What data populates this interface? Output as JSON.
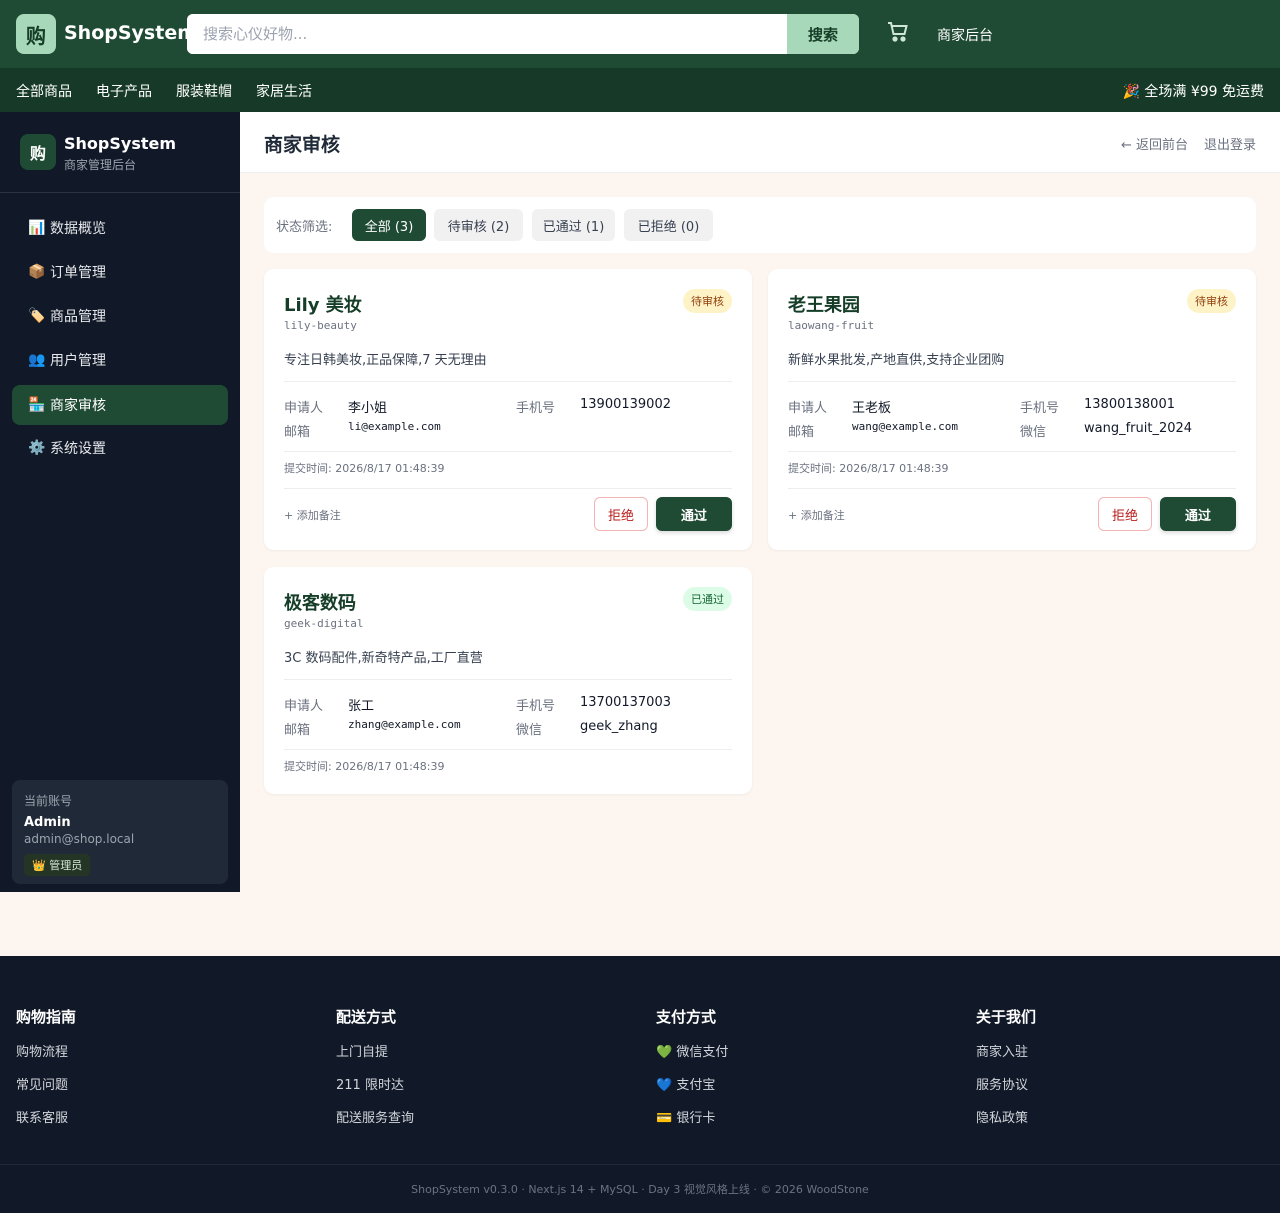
{
  "header": {
    "logo_char": "购",
    "brand": "ShopSystem",
    "search_placeholder": "搜索心仪好物...",
    "search_button": "搜索",
    "merchant_link": "商家后台"
  },
  "nav": {
    "items": [
      "全部商品",
      "电子产品",
      "服装鞋帽",
      "家居生活"
    ],
    "promo": "🎉 全场满 ¥99 免运费"
  },
  "sidebar": {
    "logo_char": "购",
    "title": "ShopSystem",
    "subtitle": "商家管理后台",
    "items": [
      {
        "icon": "📊",
        "label": "数据概览"
      },
      {
        "icon": "📦",
        "label": "订单管理"
      },
      {
        "icon": "🏷️",
        "label": "商品管理"
      },
      {
        "icon": "👥",
        "label": "用户管理"
      },
      {
        "icon": "🏪",
        "label": "商家审核"
      },
      {
        "icon": "⚙️",
        "label": "系统设置"
      }
    ],
    "active_index": 4,
    "account": {
      "label": "当前账号",
      "name": "Admin",
      "email": "admin@shop.local",
      "role": "👑 管理员"
    }
  },
  "main": {
    "title": "商家审核",
    "back_link": "← 返回前台",
    "logout": "退出登录",
    "filter": {
      "label": "状态筛选:",
      "chips": [
        "全部 (3)",
        "待审核 (2)",
        "已通过 (1)",
        "已拒绝 (0)"
      ],
      "active_index": 0
    }
  },
  "cards": [
    {
      "name": "Lily 美妆",
      "slug": "lily-beauty",
      "status": "待审核",
      "status_type": "pending",
      "desc": "专注日韩美妆,正品保障,7 天无理由",
      "applicant_label": "申请人",
      "applicant": "李小姐",
      "phone_label": "手机号",
      "phone": "13900139002",
      "email_label": "邮箱",
      "email": "li@example.com",
      "wechat_label": "",
      "wechat": "",
      "submitted": "提交时间: 2026/8/17 01:48:39",
      "add_note": "+ 添加备注",
      "reject": "拒绝",
      "approve": "通过"
    },
    {
      "name": "老王果园",
      "slug": "laowang-fruit",
      "status": "待审核",
      "status_type": "pending",
      "desc": "新鲜水果批发,产地直供,支持企业团购",
      "applicant_label": "申请人",
      "applicant": "王老板",
      "phone_label": "手机号",
      "phone": "13800138001",
      "email_label": "邮箱",
      "email": "wang@example.com",
      "wechat_label": "微信",
      "wechat": "wang_fruit_2024",
      "submitted": "提交时间: 2026/8/17 01:48:39",
      "add_note": "+ 添加备注",
      "reject": "拒绝",
      "approve": "通过"
    },
    {
      "name": "极客数码",
      "slug": "geek-digital",
      "status": "已通过",
      "status_type": "ok",
      "desc": "3C 数码配件,新奇特产品,工厂直营",
      "applicant_label": "申请人",
      "applicant": "张工",
      "phone_label": "手机号",
      "phone": "13700137003",
      "email_label": "邮箱",
      "email": "zhang@example.com",
      "wechat_label": "微信",
      "wechat": "geek_zhang",
      "submitted": "提交时间: 2026/8/17 01:48:39"
    }
  ],
  "footer": {
    "columns": [
      {
        "title": "购物指南",
        "links": [
          "购物流程",
          "常见问题",
          "联系客服"
        ]
      },
      {
        "title": "配送方式",
        "links": [
          "上门自提",
          "211 限时达",
          "配送服务查询"
        ]
      },
      {
        "title": "支付方式",
        "links": [
          "💚 微信支付",
          "💙 支付宝",
          "💳 银行卡"
        ]
      },
      {
        "title": "关于我们",
        "links": [
          "商家入驻",
          "服务协议",
          "隐私政策"
        ]
      }
    ],
    "copyright": "ShopSystem v0.3.0 · Next.js 14 + MySQL · Day 3 视觉风格上线 · © 2026 WoodStone"
  }
}
